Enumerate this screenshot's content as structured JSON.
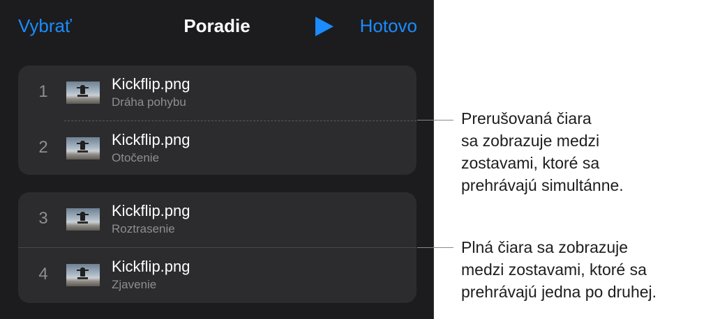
{
  "nav": {
    "select_label": "Vybrať",
    "title": "Poradie",
    "play_icon": "play-icon",
    "done_label": "Hotovo"
  },
  "groups": [
    {
      "items": [
        {
          "number": "1",
          "name": "Kickflip.png",
          "effect": "Dráha pohybu"
        },
        {
          "number": "2",
          "name": "Kickflip.png",
          "effect": "Otočenie"
        }
      ]
    },
    {
      "items": [
        {
          "number": "3",
          "name": "Kickflip.png",
          "effect": "Roztrasenie"
        },
        {
          "number": "4",
          "name": "Kickflip.png",
          "effect": "Zjavenie"
        }
      ]
    }
  ],
  "callouts": {
    "dashed": [
      "Prerušovaná čiara",
      "sa zobrazuje medzi",
      "zostavami, ktoré sa",
      "prehrávajú simultánne."
    ],
    "solid": [
      "Plná čiara sa zobrazuje",
      "medzi zostavami, ktoré sa",
      "prehrávajú jedna po druhej."
    ]
  },
  "colors": {
    "panel_background": "#1c1c1e",
    "group_background": "#2c2c2e",
    "accent": "#1a8cff"
  }
}
